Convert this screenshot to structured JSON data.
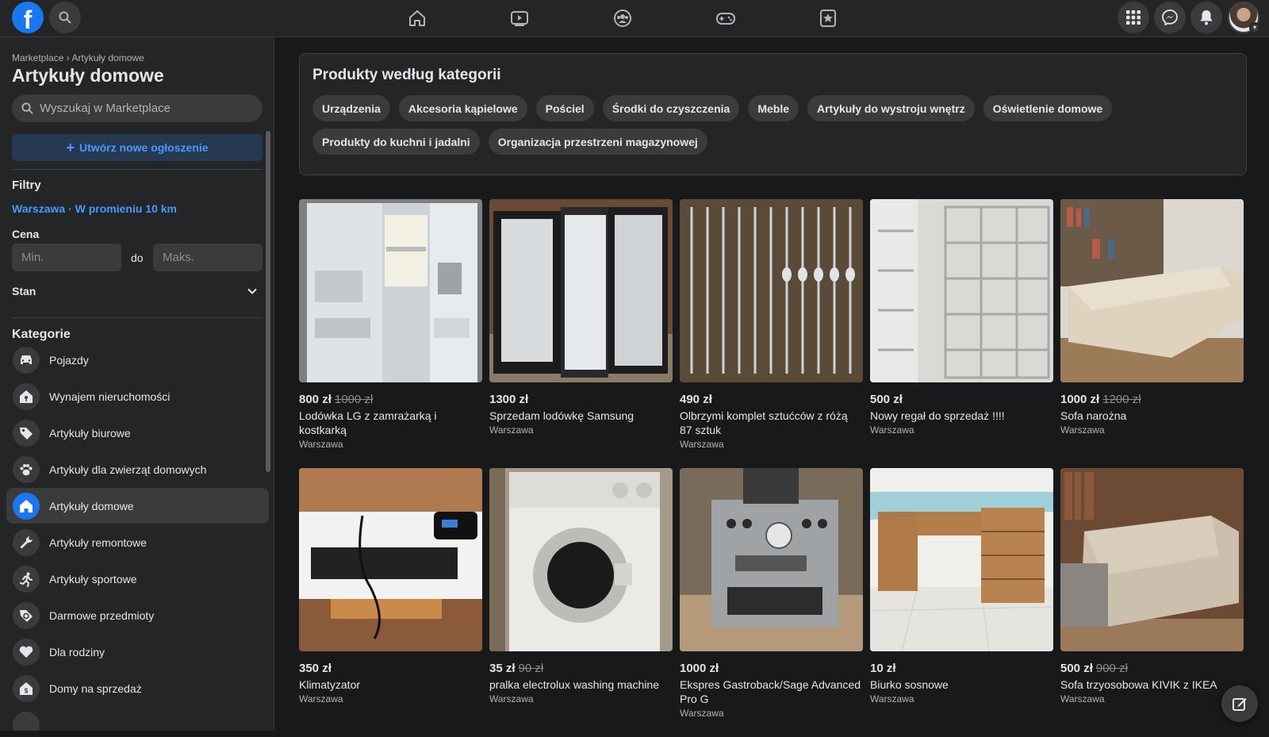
{
  "header": {
    "logo": "f",
    "nav": [
      "home-icon",
      "watch-icon",
      "groups-icon",
      "gaming-icon",
      "bookmark-star-icon"
    ],
    "right": [
      "apps-grid-icon",
      "messenger-icon",
      "notifications-icon"
    ]
  },
  "sidebar": {
    "breadcrumb": "Marketplace › Artykuły domowe",
    "title": "Artykuły domowe",
    "search_placeholder": "Wyszukaj w Marketplace",
    "create_label": "Utwórz nowe ogłoszenie",
    "filters_title": "Filtry",
    "location": "Warszawa · W promieniu 10 km",
    "price_label": "Cena",
    "min_placeholder": "Min.",
    "max_placeholder": "Maks.",
    "price_sep": "do",
    "condition_label": "Stan",
    "categories_title": "Kategorie",
    "categories": [
      {
        "label": "Pojazdy",
        "icon": "car-icon"
      },
      {
        "label": "Wynajem nieruchomości",
        "icon": "house-key-icon"
      },
      {
        "label": "Artykuły biurowe",
        "icon": "tag-icon"
      },
      {
        "label": "Artykuły dla zwierząt domowych",
        "icon": "paw-icon"
      },
      {
        "label": "Artykuły domowe",
        "icon": "home-icon",
        "active": true
      },
      {
        "label": "Artykuły remontowe",
        "icon": "wrench-icon"
      },
      {
        "label": "Artykuły sportowe",
        "icon": "running-icon"
      },
      {
        "label": "Darmowe przedmioty",
        "icon": "free-tag-icon"
      },
      {
        "label": "Dla rodziny",
        "icon": "heart-icon"
      },
      {
        "label": "Domy na sprzedaż",
        "icon": "house-sale-icon"
      }
    ]
  },
  "main": {
    "panel_title": "Produkty według kategorii",
    "chips": [
      "Urządzenia",
      "Akcesoria kąpielowe",
      "Pościel",
      "Środki do czyszczenia",
      "Meble",
      "Artykuły do wystroju wnętrz",
      "Oświetlenie domowe",
      "Produkty do kuchni i jadalni",
      "Organizacja przestrzeni magazynowej"
    ],
    "listings": [
      {
        "price": "800 zł",
        "old_price": "1000 zł",
        "title": "Lodówka LG z zamrażarką i kostkarką",
        "location": "Warszawa"
      },
      {
        "price": "1300 zł",
        "old_price": "",
        "title": "Sprzedam lodówkę Samsung",
        "location": "Warszawa"
      },
      {
        "price": "490 zł",
        "old_price": "",
        "title": "Olbrzymi komplet sztućców z różą 87 sztuk",
        "location": "Warszawa"
      },
      {
        "price": "500 zł",
        "old_price": "",
        "title": "Nowy regał do sprzedaż !!!!",
        "location": "Warszawa"
      },
      {
        "price": "1000 zł",
        "old_price": "1200 zł",
        "title": "Sofa narożna",
        "location": "Warszawa"
      },
      {
        "price": "350 zł",
        "old_price": "",
        "title": "Klimatyzator",
        "location": "Warszawa"
      },
      {
        "price": "35 zł",
        "old_price": "90 zł",
        "title": "pralka electrolux washing machine",
        "location": "Warszawa"
      },
      {
        "price": "1000 zł",
        "old_price": "",
        "title": "Ekspres Gastroback/Sage Advanced Pro G",
        "location": "Warszawa"
      },
      {
        "price": "10 zł",
        "old_price": "",
        "title": "Biurko sosnowe",
        "location": "Warszawa"
      },
      {
        "price": "500 zł",
        "old_price": "900 zł",
        "title": "Sofa trzyosobowa KIVIK z IKEA",
        "location": "Warszawa"
      }
    ]
  },
  "colors": {
    "background": "#18191a",
    "surface": "#242526",
    "chip": "#3a3b3c",
    "accent": "#1877f2",
    "link": "#4599ff"
  }
}
